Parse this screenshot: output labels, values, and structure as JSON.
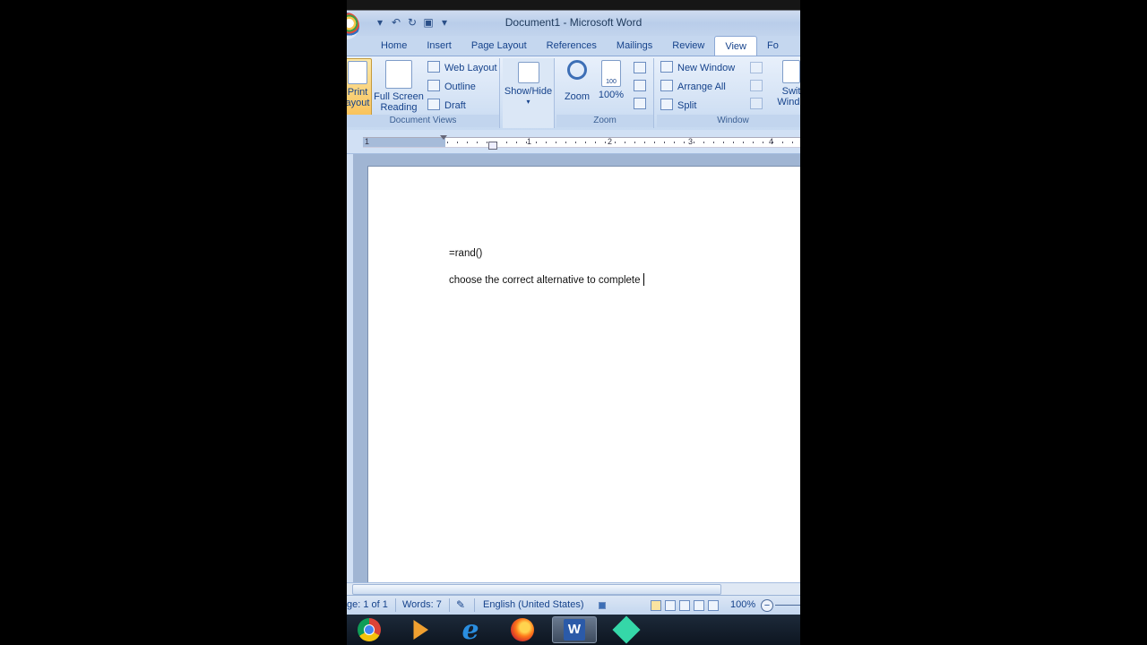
{
  "window": {
    "title": "Document1 - Microsoft Word"
  },
  "tabs": [
    "Home",
    "Insert",
    "Page Layout",
    "References",
    "Mailings",
    "Review",
    "View",
    "Fo"
  ],
  "ribbon": {
    "document_views": {
      "label": "Document Views",
      "print_layout": [
        "Print",
        "ayout"
      ],
      "full_screen_reading": [
        "Full Screen",
        "Reading"
      ],
      "web_layout": "Web Layout",
      "outline": "Outline",
      "draft": "Draft"
    },
    "show_hide": {
      "label": "Show/Hide"
    },
    "zoom": {
      "label": "Zoom",
      "zoom_button": "Zoom",
      "percent_button": "100%",
      "icon_text": "100"
    },
    "window": {
      "label": "Window",
      "new_window": "New Window",
      "arrange_all": "Arrange All",
      "split": "Split",
      "switch_windows": [
        "Swit",
        "Windo"
      ]
    }
  },
  "ruler": {
    "numbers": [
      "1",
      "1",
      "2",
      "3",
      "4"
    ]
  },
  "document": {
    "lines": [
      "=rand()",
      "choose the correct alternative to complete"
    ]
  },
  "status": {
    "page": "ge: 1 of 1",
    "words": "Words: 7",
    "language": "English (United States)",
    "zoom": "100%",
    "zoom_minus": "−"
  },
  "taskbar": {
    "items": [
      "chrome-icon",
      "vlc-icon",
      "internet-explorer-icon",
      "firefox-icon",
      "word-icon",
      "filmora-icon"
    ],
    "active": "word-icon",
    "ie_glyph": "e",
    "word_glyph": "W"
  }
}
